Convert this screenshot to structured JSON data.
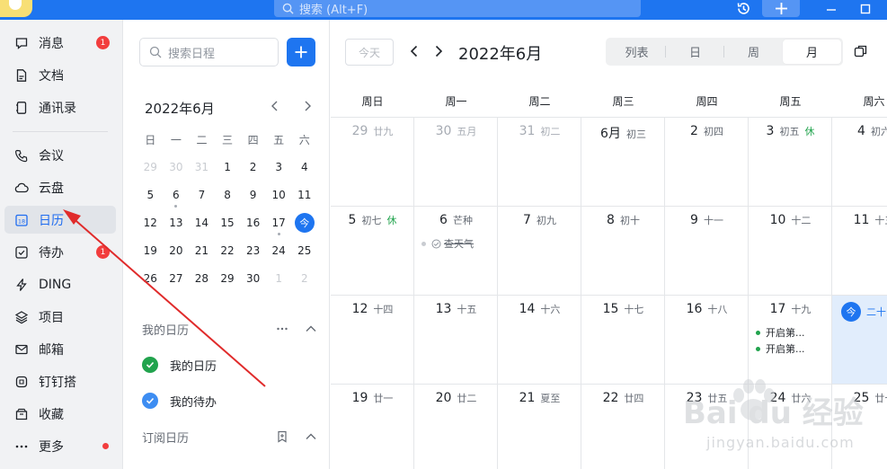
{
  "titlebar": {
    "search_placeholder": "搜索 (Alt+F)"
  },
  "nav": {
    "items": [
      {
        "label": "消息",
        "badge": "1"
      },
      {
        "label": "文档"
      },
      {
        "label": "通讯录"
      },
      {
        "label": "会议"
      },
      {
        "label": "云盘"
      },
      {
        "label": "日历"
      },
      {
        "label": "待办",
        "badge": "1"
      },
      {
        "label": "DING"
      },
      {
        "label": "项目"
      },
      {
        "label": "邮箱"
      },
      {
        "label": "钉钉搭"
      },
      {
        "label": "收藏"
      },
      {
        "label": "更多"
      }
    ]
  },
  "sidebar": {
    "search_placeholder": "搜索日程",
    "mini_calendar": {
      "title": "2022年6月",
      "weekdays": [
        "日",
        "一",
        "二",
        "三",
        "四",
        "五",
        "六"
      ],
      "weeks": [
        [
          "29",
          "30",
          "31",
          "1",
          "2",
          "3",
          "4"
        ],
        [
          "5",
          "6",
          "7",
          "8",
          "9",
          "10",
          "11"
        ],
        [
          "12",
          "13",
          "14",
          "15",
          "16",
          "17",
          "今"
        ],
        [
          "19",
          "20",
          "21",
          "22",
          "23",
          "24",
          "25"
        ],
        [
          "26",
          "27",
          "28",
          "29",
          "30",
          "1",
          "2"
        ]
      ]
    },
    "my_calendars_title": "我的日历",
    "my_calendars": [
      "我的日历",
      "我的待办"
    ],
    "subscribed_title": "订阅日历",
    "calendar_colors": {
      "mine": "#21a34d",
      "todo": "#3d8df2"
    }
  },
  "main": {
    "today_label": "今天",
    "month_title": "2022年6月",
    "views": [
      "列表",
      "日",
      "周",
      "月"
    ],
    "selected_view": "月",
    "weekdays": [
      "周日",
      "周一",
      "周二",
      "周三",
      "周四",
      "周五",
      "周六"
    ],
    "weeks": [
      [
        {
          "d": "29",
          "l": "廿九"
        },
        {
          "d": "30",
          "l": "五月"
        },
        {
          "d": "31",
          "l": "初二"
        },
        {
          "d": "6月",
          "l": "初三"
        },
        {
          "d": "2",
          "l": "初四"
        },
        {
          "d": "3",
          "l": "初五",
          "h": "休"
        },
        {
          "d": "4",
          "l": "初六"
        }
      ],
      [
        {
          "d": "5",
          "l": "初七",
          "h": "休"
        },
        {
          "d": "6",
          "l": "芒种"
        },
        {
          "d": "7",
          "l": "初九"
        },
        {
          "d": "8",
          "l": "初十"
        },
        {
          "d": "9",
          "l": "十一"
        },
        {
          "d": "10",
          "l": "十二"
        },
        {
          "d": "11",
          "l": "十三"
        }
      ],
      [
        {
          "d": "12",
          "l": "十四"
        },
        {
          "d": "13",
          "l": "十五"
        },
        {
          "d": "14",
          "l": "十六"
        },
        {
          "d": "15",
          "l": "十七"
        },
        {
          "d": "16",
          "l": "十八"
        },
        {
          "d": "17",
          "l": "十九"
        },
        {
          "d": "今",
          "l": "二十"
        }
      ],
      [
        {
          "d": "19",
          "l": "廿一"
        },
        {
          "d": "20",
          "l": "廿二"
        },
        {
          "d": "21",
          "l": "夏至"
        },
        {
          "d": "22",
          "l": "廿四"
        },
        {
          "d": "23",
          "l": "廿五"
        },
        {
          "d": "24",
          "l": "廿六"
        },
        {
          "d": "25",
          "l": "廿七"
        }
      ]
    ],
    "events": {
      "weather": "查天气",
      "fri17_1": "开启第...",
      "fri17_2": "开启第..."
    }
  },
  "watermark": {
    "line1": "Bai du 经验",
    "line2": "jingyan.baidu.com"
  },
  "accent": "#1e75f0"
}
